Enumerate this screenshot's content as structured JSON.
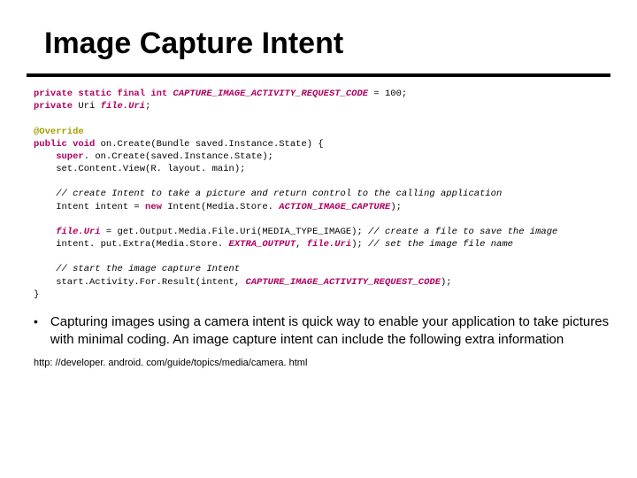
{
  "title": "Image Capture Intent",
  "code": {
    "l01a": "private static final int ",
    "l01b": "CAPTURE_IMAGE_ACTIVITY_REQUEST_CODE",
    "l01c": " = 100;",
    "l02a": "private ",
    "l02b": "Uri ",
    "l02c": "file.Uri",
    "l02d": ";",
    "l03": "",
    "l04": "@Override",
    "l05a": "public void ",
    "l05b": "on.Create(Bundle saved.Instance.State) {",
    "l06a": "    super",
    "l06b": ". on.Create(saved.Instance.State);",
    "l07": "    set.Content.View(R. layout. main);",
    "l08": "",
    "l09": "    // create Intent to take a picture and return control to the calling application",
    "l10a": "    Intent intent = ",
    "l10b": "new ",
    "l10c": "Intent(Media.Store. ",
    "l10d": "ACTION_IMAGE_CAPTURE",
    "l10e": ");",
    "l11": "",
    "l12a": "    file.Uri",
    "l12b": " = get.Output.Media.File.Uri(MEDIA_TYPE_IMAGE); ",
    "l12c": "// create a file to save the image",
    "l13a": "    intent. put.Extra(Media.Store. ",
    "l13b": "EXTRA_OUTPUT",
    "l13c": ", ",
    "l13d": "file.Uri",
    "l13e": "); ",
    "l13f": "// set the image file name",
    "l14": "",
    "l15": "    // start the image capture Intent",
    "l16a": "    start.Activity.For.Result(intent, ",
    "l16b": "CAPTURE_IMAGE_ACTIVITY_REQUEST_CODE",
    "l16c": ");",
    "l17": "}"
  },
  "bullet": "Capturing images using a camera intent is quick way to enable your application to take pictures with minimal coding. An image capture intent can include the following extra information",
  "footer": "http: //developer. android. com/guide/topics/media/camera. html"
}
